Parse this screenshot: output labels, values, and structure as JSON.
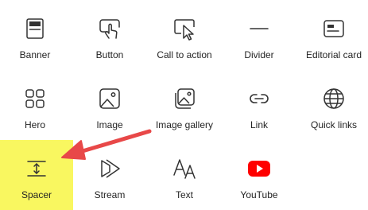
{
  "items": [
    {
      "label": "Banner",
      "icon": "banner-icon"
    },
    {
      "label": "Button",
      "icon": "button-pointer-icon"
    },
    {
      "label": "Call to action",
      "icon": "call-to-action-icon"
    },
    {
      "label": "Divider",
      "icon": "divider-icon"
    },
    {
      "label": "Editorial card",
      "icon": "editorial-card-icon"
    },
    {
      "label": "Hero",
      "icon": "hero-icon"
    },
    {
      "label": "Image",
      "icon": "image-icon"
    },
    {
      "label": "Image gallery",
      "icon": "image-gallery-icon"
    },
    {
      "label": "Link",
      "icon": "link-icon"
    },
    {
      "label": "Quick links",
      "icon": "globe-icon"
    },
    {
      "label": "Spacer",
      "icon": "spacer-icon",
      "highlighted": true
    },
    {
      "label": "Stream",
      "icon": "stream-icon"
    },
    {
      "label": "Text",
      "icon": "text-icon"
    },
    {
      "label": "YouTube",
      "icon": "youtube-icon"
    }
  ],
  "colors": {
    "highlight": "#f9f760",
    "arrow": "#e84848",
    "youtube": "#ff0000",
    "icon_stroke": "#333333"
  },
  "annotation": {
    "type": "arrow",
    "points_to": "Spacer"
  }
}
